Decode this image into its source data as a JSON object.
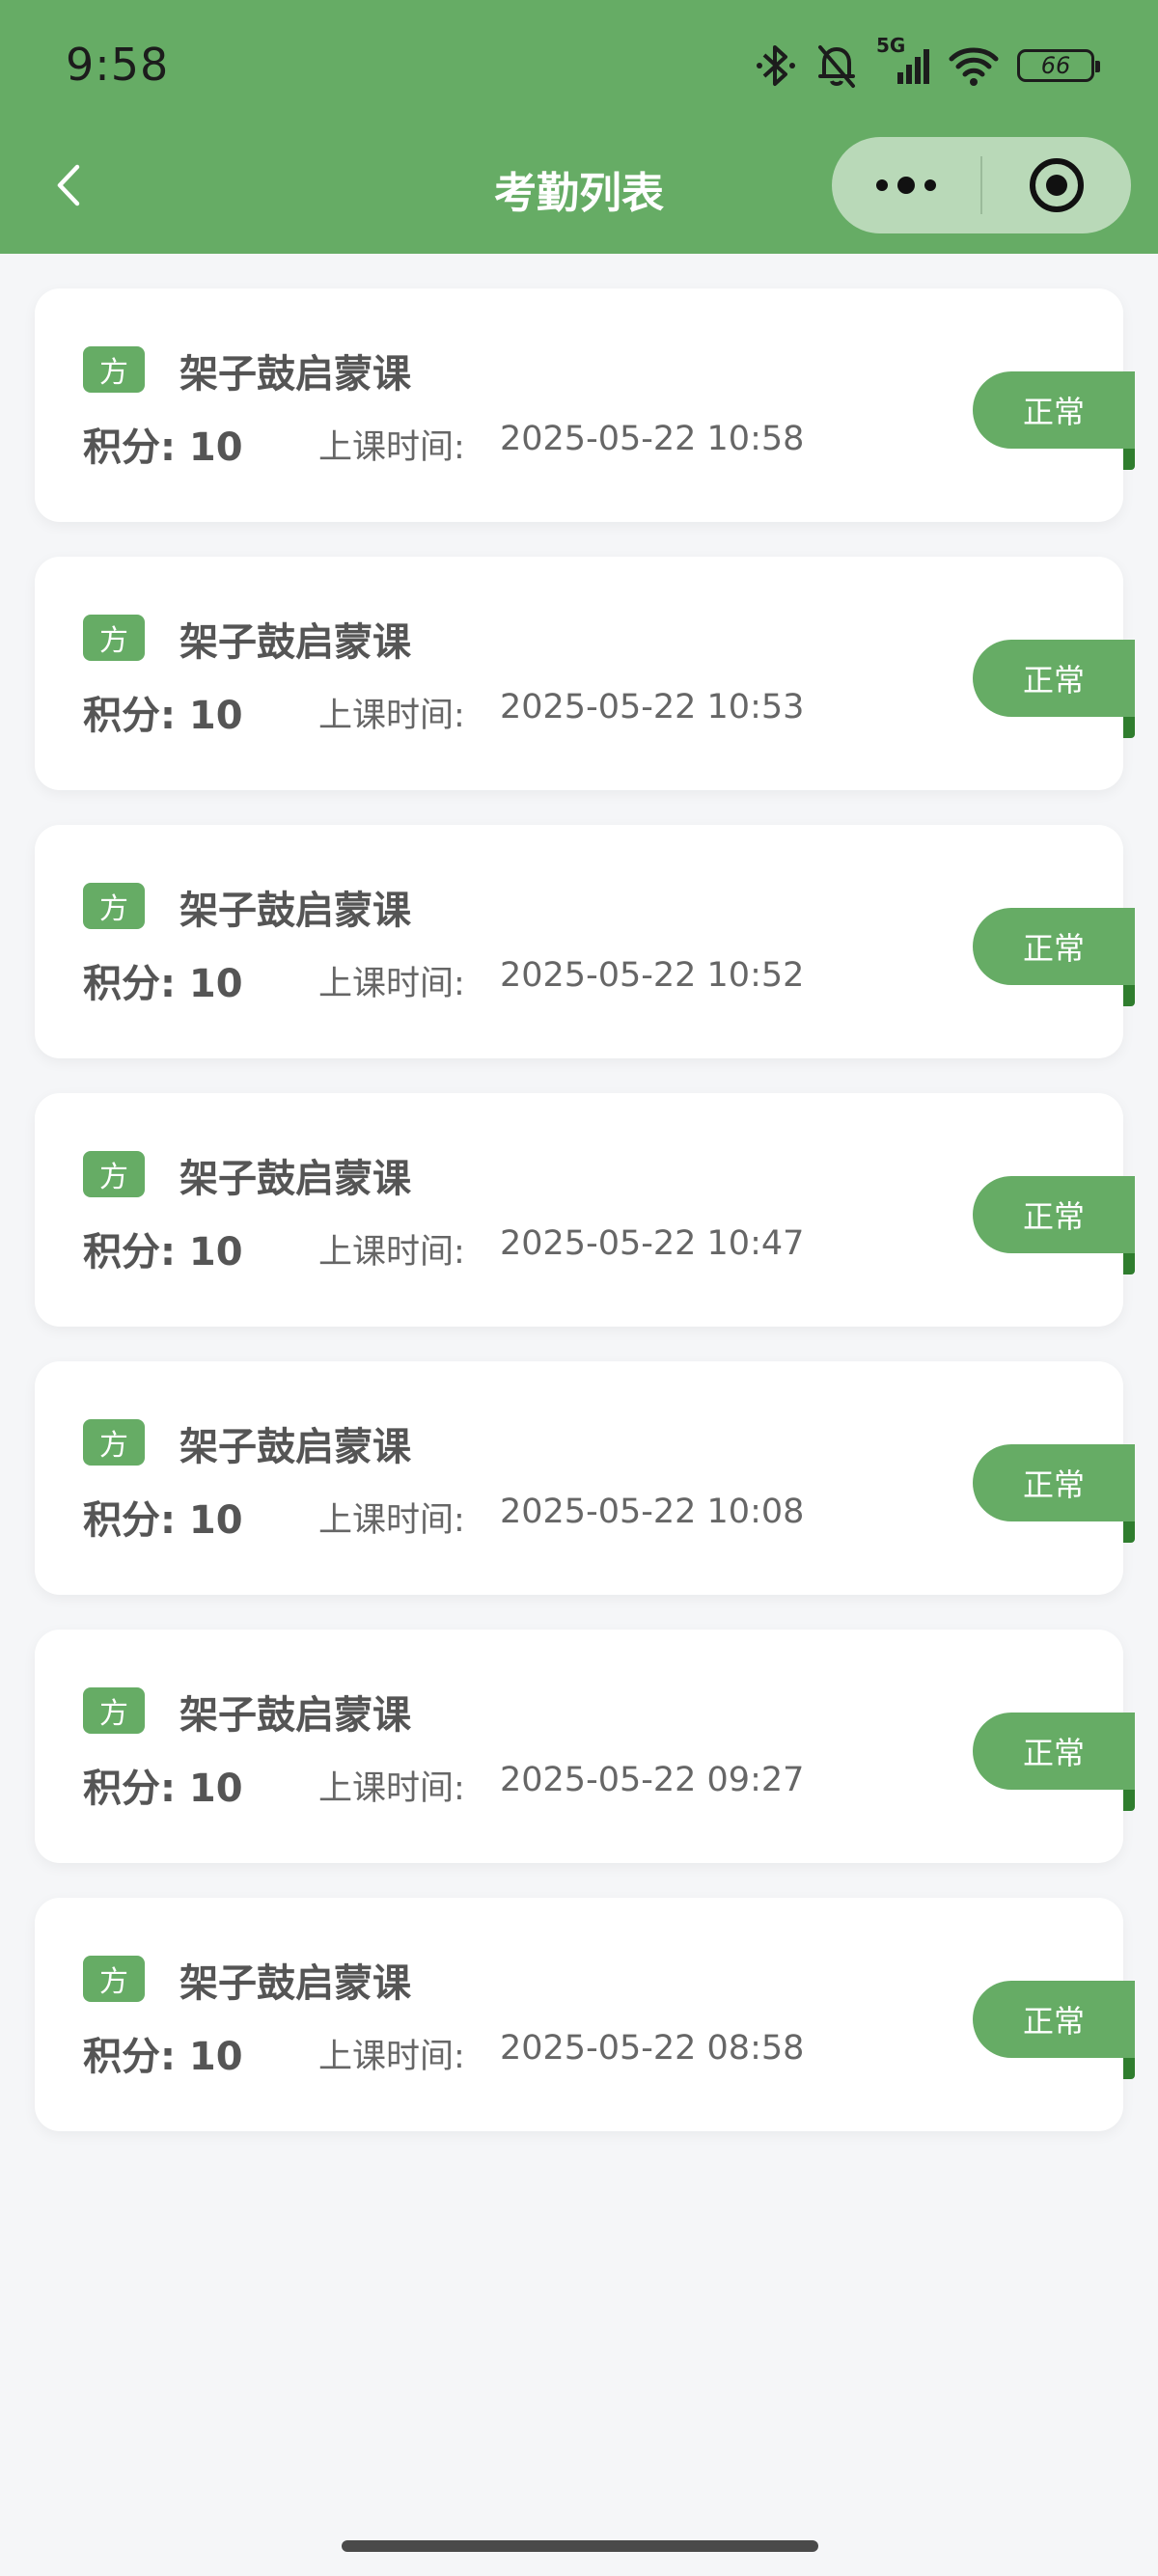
{
  "status_bar": {
    "time": "9:58",
    "network": "5G",
    "battery": "66",
    "icons": [
      "bluetooth-icon",
      "bell-off-icon",
      "signal-icon",
      "wifi-icon",
      "battery-icon"
    ]
  },
  "nav": {
    "title": "考勤列表",
    "back_icon": "chevron-left-icon",
    "more_icon": "more-dots-icon",
    "close_icon": "target-circle-icon"
  },
  "colors": {
    "primary": "#66ac65",
    "primary_dark": "#2f7d2e",
    "background": "#f5f6f8",
    "card": "#ffffff",
    "text": "#555555"
  },
  "records": [
    {
      "tag": "方",
      "title": "架子鼓启蒙课",
      "points": "积分: 10",
      "time_label": "上课时间:",
      "time": "2025-05-22 10:58",
      "status": "正常"
    },
    {
      "tag": "方",
      "title": "架子鼓启蒙课",
      "points": "积分: 10",
      "time_label": "上课时间:",
      "time": "2025-05-22 10:53",
      "status": "正常"
    },
    {
      "tag": "方",
      "title": "架子鼓启蒙课",
      "points": "积分: 10",
      "time_label": "上课时间:",
      "time": "2025-05-22 10:52",
      "status": "正常"
    },
    {
      "tag": "方",
      "title": "架子鼓启蒙课",
      "points": "积分: 10",
      "time_label": "上课时间:",
      "time": "2025-05-22 10:47",
      "status": "正常"
    },
    {
      "tag": "方",
      "title": "架子鼓启蒙课",
      "points": "积分: 10",
      "time_label": "上课时间:",
      "time": "2025-05-22 10:08",
      "status": "正常"
    },
    {
      "tag": "方",
      "title": "架子鼓启蒙课",
      "points": "积分: 10",
      "time_label": "上课时间:",
      "time": "2025-05-22 09:27",
      "status": "正常"
    },
    {
      "tag": "方",
      "title": "架子鼓启蒙课",
      "points": "积分: 10",
      "time_label": "上课时间:",
      "time": "2025-05-22 08:58",
      "status": "正常"
    }
  ]
}
